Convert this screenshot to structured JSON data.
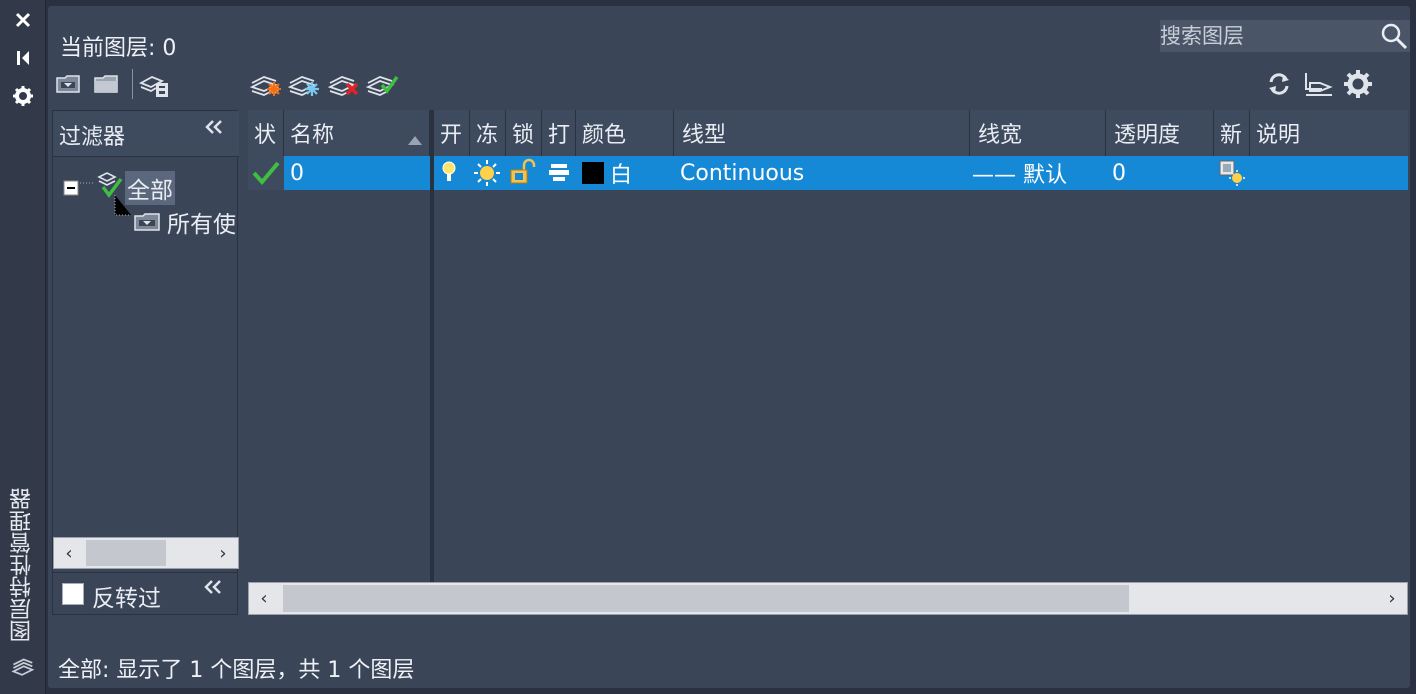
{
  "palette": {
    "title": "图层特性管理器"
  },
  "header": {
    "current_layer": "当前图层: 0"
  },
  "search": {
    "placeholder": "搜索图层"
  },
  "filters": {
    "title": "过滤器",
    "tree": [
      {
        "label": "全部"
      },
      {
        "label": "所有使"
      }
    ],
    "invert_label": "反转过"
  },
  "grid": {
    "columns": [
      {
        "label": "状"
      },
      {
        "label": "名称"
      },
      {
        "label": "开"
      },
      {
        "label": "冻"
      },
      {
        "label": "锁"
      },
      {
        "label": "打"
      },
      {
        "label": "颜色"
      },
      {
        "label": "线型"
      },
      {
        "label": "线宽"
      },
      {
        "label": "透明度"
      },
      {
        "label": "新"
      },
      {
        "label": "说明"
      }
    ],
    "rows": [
      {
        "name": "0",
        "color_name": "白",
        "color_hex": "#000000",
        "linetype": "Continuous",
        "lineweight": "—— 默认",
        "transparency": "0",
        "description": ""
      }
    ]
  },
  "status": {
    "text": "全部: 显示了 1 个图层，共 1 个图层"
  },
  "colors": {
    "background": "#2b3140",
    "panel": "#3b4558",
    "header": "#3e4a5e",
    "selection": "#1689d6",
    "check": "#3fbf3f"
  }
}
